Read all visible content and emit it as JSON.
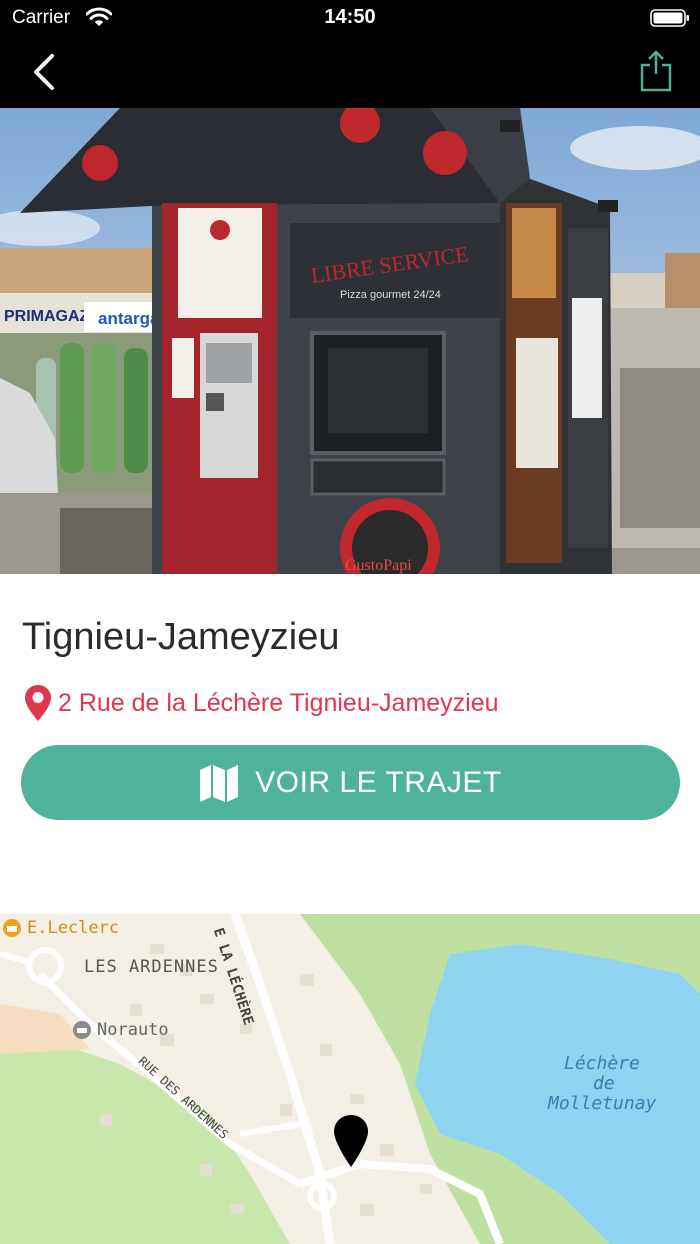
{
  "status_bar": {
    "carrier": "Carrier",
    "time": "14:50"
  },
  "nav": {
    "back_icon": "chevron-left-icon",
    "share_icon": "share-icon"
  },
  "hero": {
    "sign_text": "LIBRE SERVICE",
    "sign_subtext": "Pizza gourmet 24/24",
    "brand_text": "GustoPapi",
    "left_shop_sign": "PRIMAGAZ",
    "right_shop_sign": "antargaz"
  },
  "place": {
    "title": "Tignieu-Jameyzieu",
    "address": "2 Rue de la Léchère Tignieu-Jameyzieu"
  },
  "route_button": {
    "label": "VOIR LE TRAJET",
    "icon": "map-icon"
  },
  "map": {
    "poi_leclerc": "E.Leclerc",
    "district": "LES ARDENNES",
    "poi_norauto": "Norauto",
    "street_lechere": "E LA LÉCHÈRE",
    "street_ardennes": "RUE DES ARDENNES",
    "lake_line1": "Léchère",
    "lake_line2": "de",
    "lake_line3": "Molletunay"
  },
  "colors": {
    "accent": "#4fb39c",
    "address": "#e0364f",
    "header": "#000000"
  }
}
